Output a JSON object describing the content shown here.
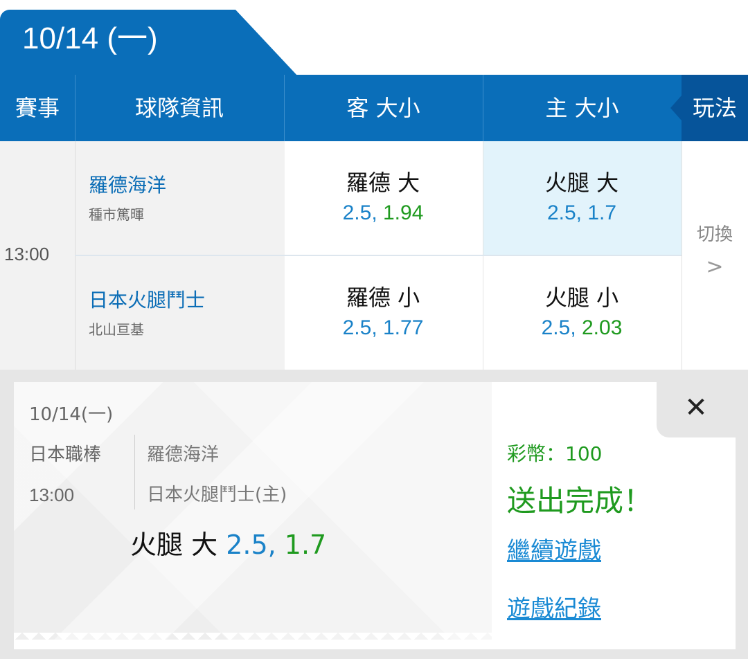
{
  "date_tab": "10/14 (一)",
  "header": {
    "event": "賽事",
    "team_info": "球隊資訊",
    "away_ou": "客 大小",
    "home_ou": "主 大小",
    "play": "玩法"
  },
  "match": {
    "time": "13:00",
    "away_team": "羅德海洋",
    "away_pitcher": "種市篤暉",
    "home_team": "日本火腿鬥士",
    "home_pitcher": "北山亘基",
    "odds": [
      {
        "title": "羅德 大",
        "line": "2.5,",
        "price": "1.94"
      },
      {
        "title": "火腿 大",
        "line": "2.5,",
        "price": "1.7"
      },
      {
        "title": "羅德 小",
        "line": "2.5,",
        "price": "1.77"
      },
      {
        "title": "火腿 小",
        "line": "2.5,",
        "price": "2.03"
      }
    ],
    "switch_label": "切換",
    "switch_arrow": ">"
  },
  "ticket": {
    "date": "10/14(一)",
    "league": "日本職棒",
    "time": "13:00",
    "away": "羅德海洋",
    "home": "日本火腿鬥士(主)",
    "pick_title": "火腿 大",
    "pick_line": "2.5,",
    "pick_price": "1.7"
  },
  "result": {
    "coins": "彩幣：100",
    "status": "送出完成！",
    "continue_link": "繼續遊戲",
    "history_link": "遊戲紀錄"
  },
  "close_symbol": "✕",
  "colors": {
    "primary_blue": "#0a6eb9",
    "odds_blue": "#1a82c8",
    "odds_green": "#1f9a1f",
    "highlight": "#e2f3fb"
  }
}
